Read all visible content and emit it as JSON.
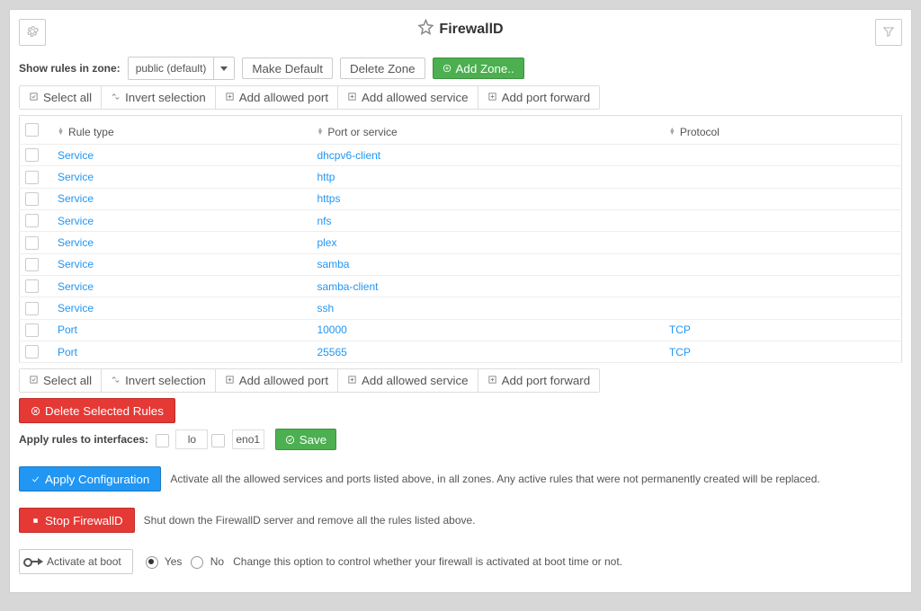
{
  "header": {
    "title": "FirewallD"
  },
  "zonebar": {
    "label": "Show rules in zone:",
    "selected": "public (default)",
    "make_default": "Make Default",
    "delete_zone": "Delete Zone",
    "add_zone": "Add Zone.."
  },
  "toolbar": {
    "select_all": "Select all",
    "invert": "Invert selection",
    "add_port": "Add allowed port",
    "add_service": "Add allowed service",
    "add_fwd": "Add port forward"
  },
  "table": {
    "col_rule": "Rule type",
    "col_port": "Port or service",
    "col_proto": "Protocol",
    "rows": [
      {
        "type": "Service",
        "port": "dhcpv6-client",
        "proto": ""
      },
      {
        "type": "Service",
        "port": "http",
        "proto": ""
      },
      {
        "type": "Service",
        "port": "https",
        "proto": ""
      },
      {
        "type": "Service",
        "port": "nfs",
        "proto": ""
      },
      {
        "type": "Service",
        "port": "plex",
        "proto": ""
      },
      {
        "type": "Service",
        "port": "samba",
        "proto": ""
      },
      {
        "type": "Service",
        "port": "samba-client",
        "proto": ""
      },
      {
        "type": "Service",
        "port": "ssh",
        "proto": ""
      },
      {
        "type": "Port",
        "port": "10000",
        "proto": "TCP"
      },
      {
        "type": "Port",
        "port": "25565",
        "proto": "TCP"
      }
    ]
  },
  "delete_selected": "Delete Selected Rules",
  "interfaces": {
    "label": "Apply rules to interfaces:",
    "items": [
      "lo",
      "eno1"
    ],
    "save": "Save"
  },
  "apply": {
    "btn": "Apply Configuration",
    "desc": "Activate all the allowed services and ports listed above, in all zones. Any active rules that were not permanently created will be replaced."
  },
  "stop": {
    "btn": "Stop FirewallD",
    "desc": "Shut down the FirewallD server and remove all the rules listed above."
  },
  "boot": {
    "btn": "Activate at boot",
    "yes": "Yes",
    "no": "No",
    "desc": "Change this option to control whether your firewall is activated at boot time or not."
  }
}
